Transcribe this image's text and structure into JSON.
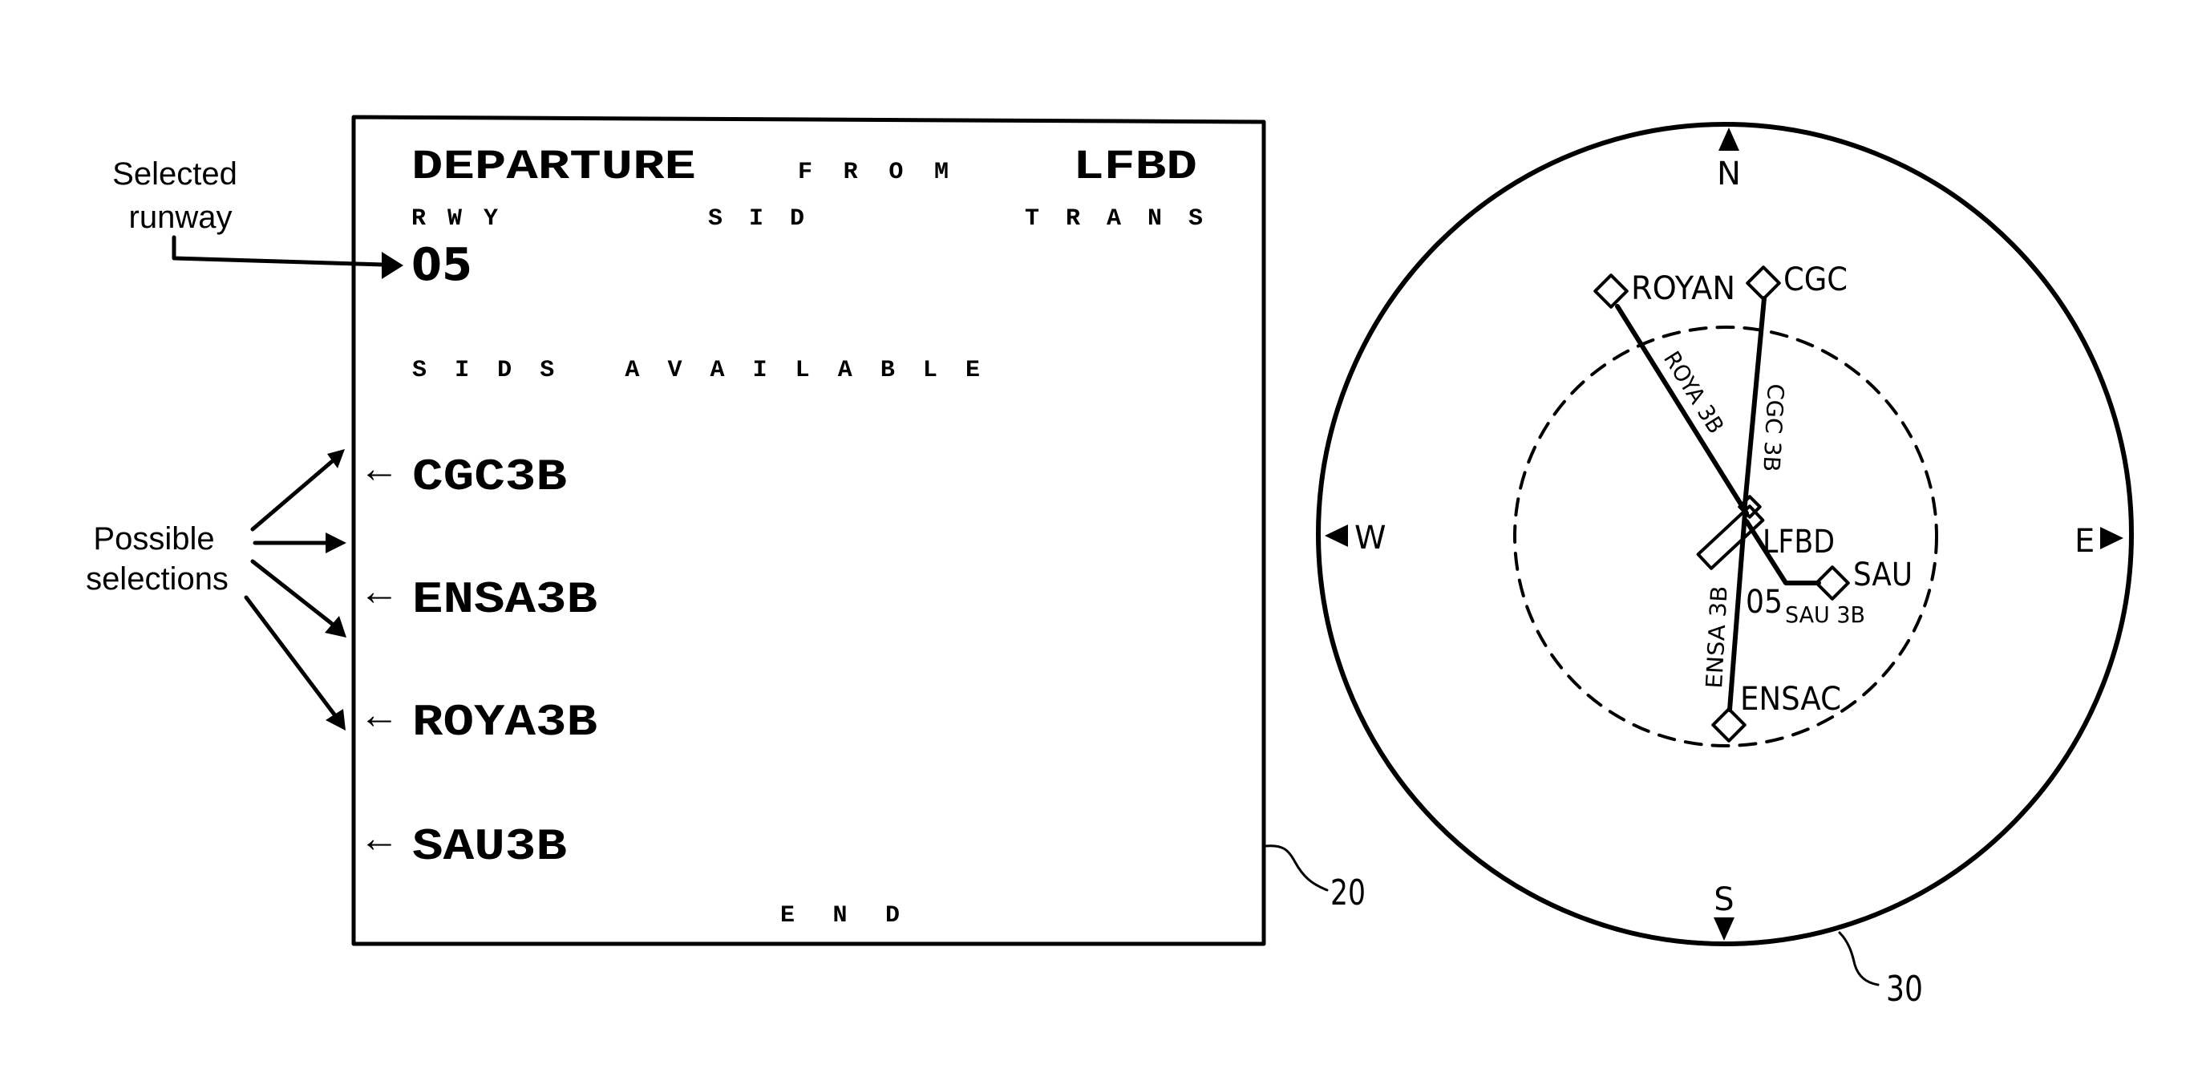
{
  "figure": {
    "ref_display": "20",
    "ref_map": "30"
  },
  "annotations": {
    "selected_runway": [
      "Selected",
      "runway"
    ],
    "possible_selections": [
      "Possible",
      "selections"
    ]
  },
  "display": {
    "title_departure": "DEPARTURE",
    "title_from": "F R O M",
    "title_airport": "LFBD",
    "col_rwy": "R W Y",
    "col_sid": "S I D",
    "col_trans": "T R A N S",
    "selected_runway": "05",
    "sids_available": "S I D S   A V A I L A B L E",
    "arrow_glyph": "←",
    "sids": [
      {
        "label": "CGC3B"
      },
      {
        "label": "ENSA3B"
      },
      {
        "label": "ROYA3B"
      },
      {
        "label": "SAU3B"
      }
    ],
    "end_label": "E N D"
  },
  "map": {
    "compass": {
      "north": "N",
      "south": "S",
      "east": "E",
      "west": "W"
    },
    "airport": "LFBD",
    "runway": "05",
    "waypoints": [
      {
        "name": "ROYAN"
      },
      {
        "name": "CGC"
      },
      {
        "name": "SAU"
      },
      {
        "name": "ENSAC"
      }
    ],
    "routes": [
      {
        "label": "ROYA 3B"
      },
      {
        "label": "CGC 3B"
      },
      {
        "label": "ENSA 3B"
      },
      {
        "label": "SAU 3B"
      }
    ]
  }
}
